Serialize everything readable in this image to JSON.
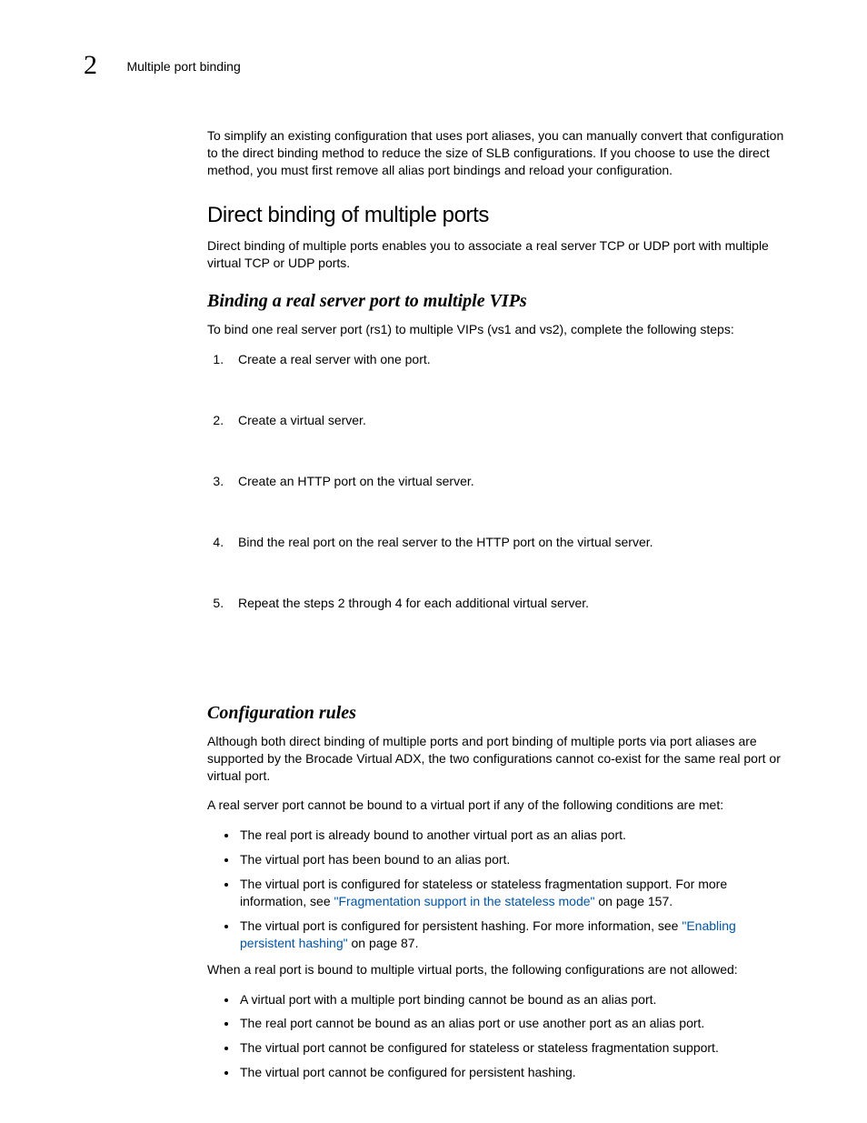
{
  "header": {
    "chapter_number": "2",
    "section_title": "Multiple port binding"
  },
  "intro": "To simplify an existing configuration that uses port aliases, you can manually convert that configuration to the direct binding method to reduce the size of SLB configurations. If you choose to use the direct method, you must first remove all alias port bindings and reload your configuration.",
  "section1": {
    "title": "Direct binding of multiple ports",
    "body": "Direct binding of multiple ports enables you to associate a real server TCP or UDP port with multiple virtual TCP or UDP ports."
  },
  "section2": {
    "title": "Binding a real server port to multiple VIPs",
    "intro": "To bind one real server port (rs1) to multiple VIPs (vs1 and vs2), complete the following steps:",
    "steps": [
      "Create a real server with one port.",
      "Create a virtual server.",
      "Create an HTTP port on the virtual server.",
      "Bind the real port on the real server to the HTTP port on the virtual server.",
      "Repeat the steps 2 through 4 for each additional virtual server."
    ]
  },
  "section3": {
    "title": "Configuration rules",
    "paragraph1": "Although both direct binding of multiple ports and port binding of multiple ports via port aliases are supported by the Brocade Virtual ADX, the two configurations cannot co-exist for the same real port or virtual port.",
    "paragraph2": "A real server port cannot be bound to a virtual port if any of the following conditions are met:",
    "bullets1": [
      {
        "text": "The real port is already bound to another virtual port as an alias port."
      },
      {
        "text": "The virtual port has been bound to an alias port."
      },
      {
        "text_before": "The virtual port is configured for stateless or stateless fragmentation support. For more information, see ",
        "link": "\"Fragmentation support in the stateless mode\"",
        "text_after": " on page 157."
      },
      {
        "text_before": "The virtual port is configured for persistent hashing. For more information, see ",
        "link": "\"Enabling persistent hashing\"",
        "text_after": " on page 87."
      }
    ],
    "paragraph3": "When a real port is bound to multiple virtual ports, the following configurations are not allowed:",
    "bullets2": [
      "A virtual port with a multiple port binding cannot be bound as an alias port.",
      "The real port cannot be bound as an alias port or use another port as an alias port.",
      "The virtual port cannot be configured for stateless or stateless fragmentation support.",
      "The virtual port cannot be configured for persistent hashing."
    ]
  }
}
